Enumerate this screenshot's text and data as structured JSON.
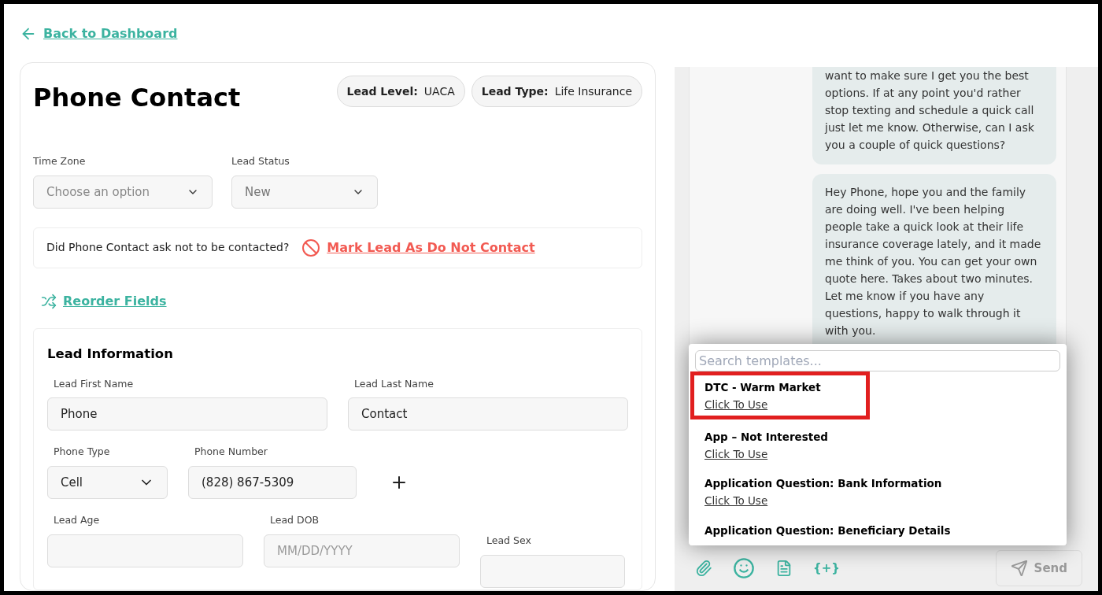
{
  "back_link": "Back to Dashboard",
  "contact": {
    "title": "Phone Contact",
    "badges": [
      {
        "label": "Lead Level:",
        "value": "UACA"
      },
      {
        "label": "Lead Type:",
        "value": "Life Insurance"
      }
    ]
  },
  "selects": [
    {
      "label": "Time Zone",
      "placeholder": "Choose an option"
    },
    {
      "label": "Lead Status",
      "value": "New"
    }
  ],
  "dnc": {
    "question": "Did Phone Contact ask not to be contacted?",
    "action": "Mark Lead As Do Not Contact"
  },
  "reorder": "Reorder Fields",
  "lead_info": {
    "title": "Lead Information",
    "name_fields": [
      {
        "label": "Lead First Name",
        "value": "Phone"
      },
      {
        "label": "Lead Last Name",
        "value": "Contact"
      }
    ],
    "phone_type": {
      "label": "Phone Type",
      "value": "Cell"
    },
    "phone_number": {
      "label": "Phone Number",
      "value": "(828) 867-5309"
    },
    "age": {
      "label": "Lead Age"
    },
    "dob": {
      "label": "Lead DOB",
      "placeholder": "MM/DD/YYYY"
    },
    "sex": {
      "label": "Lead Sex"
    }
  },
  "chat": {
    "messages": [
      "want to make sure I get you the best options. If at any point you'd rather stop texting and schedule a quick call just let me know. Otherwise, can I ask you a couple of quick questions?",
      "Hey Phone, hope you and the family are doing well. I've been helping people take a quick look at their life insurance coverage lately, and it made me think of you. You can get your own quote here. Takes about two minutes. Let me know if you have any questions, happy to walk through it with you."
    ],
    "templates": {
      "placeholder": "Search templates...",
      "items": [
        {
          "name": "DTC - Warm Market",
          "action": "Click To Use",
          "highlighted": true
        },
        {
          "name": "App – Not Interested",
          "action": "Click To Use",
          "highlighted": false
        },
        {
          "name": "Application Question: Bank Information",
          "action": "Click To Use",
          "highlighted": false
        },
        {
          "name": "Application Question: Beneficiary Details",
          "highlighted": false
        }
      ]
    },
    "variable_button": "{+}",
    "send": {
      "label": "Send",
      "disabled": true
    }
  }
}
